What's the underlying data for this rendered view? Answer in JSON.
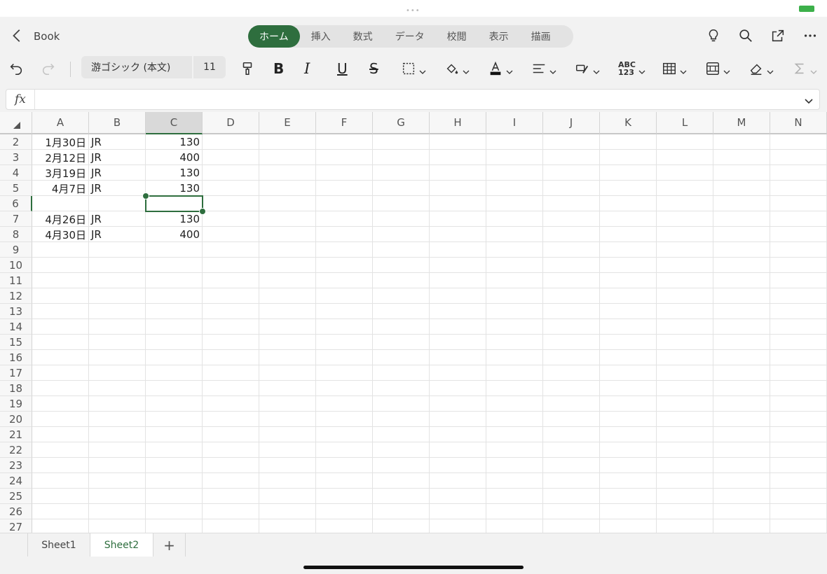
{
  "topbar": {
    "back_icon": "chevron-left-icon",
    "book_title": "Book",
    "tabs": [
      {
        "label": "ホーム",
        "active": true
      },
      {
        "label": "挿入",
        "active": false
      },
      {
        "label": "数式",
        "active": false
      },
      {
        "label": "データ",
        "active": false
      },
      {
        "label": "校閲",
        "active": false
      },
      {
        "label": "表示",
        "active": false
      },
      {
        "label": "描画",
        "active": false
      }
    ],
    "icons": [
      "lightbulb-icon",
      "search-icon",
      "share-icon",
      "more-icon"
    ]
  },
  "ribbon": {
    "font_name": "游ゴシック (本文)",
    "font_size": "11",
    "bold_label": "B",
    "italic_label": "I",
    "underline_label": "U",
    "strike_label": "S",
    "number_format_label": "ABC\n123"
  },
  "formula_bar": {
    "fx_label": "fx",
    "value": ""
  },
  "grid": {
    "columns": [
      "A",
      "B",
      "C",
      "D",
      "E",
      "F",
      "G",
      "H",
      "I",
      "J",
      "K",
      "L",
      "M",
      "N"
    ],
    "selected_column": "C",
    "rows": [
      "2",
      "3",
      "4",
      "5",
      "6",
      "7",
      "8",
      "9",
      "10",
      "11",
      "12",
      "13",
      "14",
      "15",
      "16",
      "17",
      "18",
      "19",
      "20",
      "21",
      "22",
      "23",
      "24",
      "25",
      "26",
      "27"
    ],
    "selected_row": "6",
    "data": [
      {
        "row": "2",
        "A": "1月30日",
        "B": "JR",
        "C": "130"
      },
      {
        "row": "3",
        "A": "2月12日",
        "B": "JR",
        "C": "400"
      },
      {
        "row": "4",
        "A": "3月19日",
        "B": "JR",
        "C": "130"
      },
      {
        "row": "5",
        "A": "4月7日",
        "B": "JR",
        "C": "130"
      },
      {
        "row": "6",
        "A": "",
        "B": "",
        "C": ""
      },
      {
        "row": "7",
        "A": "4月26日",
        "B": "JR",
        "C": "130"
      },
      {
        "row": "8",
        "A": "4月30日",
        "B": "JR",
        "C": "400"
      }
    ],
    "accent_color": "#2e6e3e"
  },
  "sheets": [
    {
      "label": "Sheet1",
      "active": false
    },
    {
      "label": "Sheet2",
      "active": true
    }
  ],
  "add_sheet_label": "+"
}
